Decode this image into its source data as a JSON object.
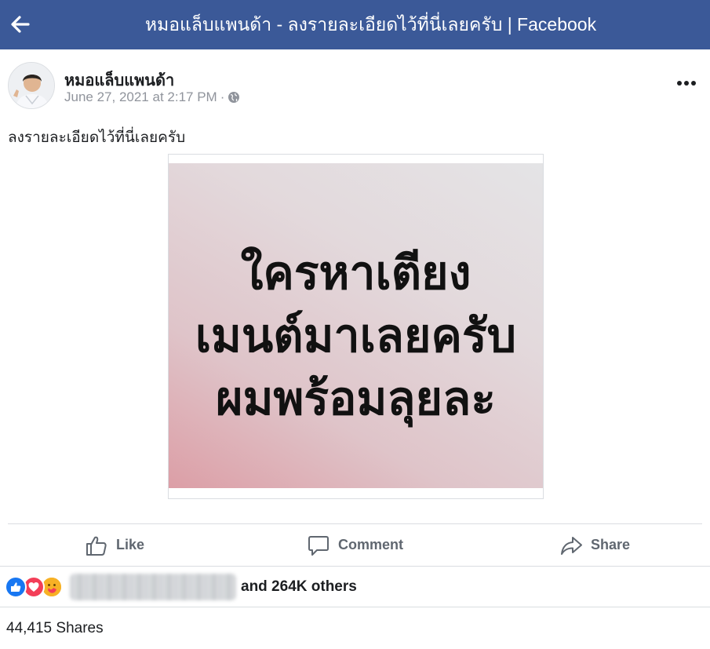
{
  "topbar": {
    "title": "หมอแล็บแพนด้า - ลงรายละเอียดไว้ที่นี่เลยครับ | Facebook",
    "back_icon": "arrow-left-icon",
    "background": "#3b5998"
  },
  "post": {
    "author": "หมอแล็บแพนด้า",
    "timestamp": "June 27, 2021 at 2:17 PM",
    "meta_separator": "·",
    "privacy_icon": "globe-icon",
    "more_icon": "more-horizontal-icon",
    "caption": "ลงรายละเอียดไว้ที่นี่เลยครับ",
    "image_text": {
      "line1": "ใครหาเตียง",
      "line2": "เมนต์มาเลยครับ",
      "line3": "ผมพร้อมลุยละ"
    }
  },
  "actions": {
    "like": "Like",
    "comment": "Comment",
    "share": "Share"
  },
  "reactions": {
    "icons": [
      "like-reaction-icon",
      "love-reaction-icon",
      "care-reaction-icon"
    ],
    "others_text": "and 264K others",
    "like_color": "#1877f2",
    "love_color": "#f33e58"
  },
  "shares": {
    "text": "44,415 Shares"
  }
}
